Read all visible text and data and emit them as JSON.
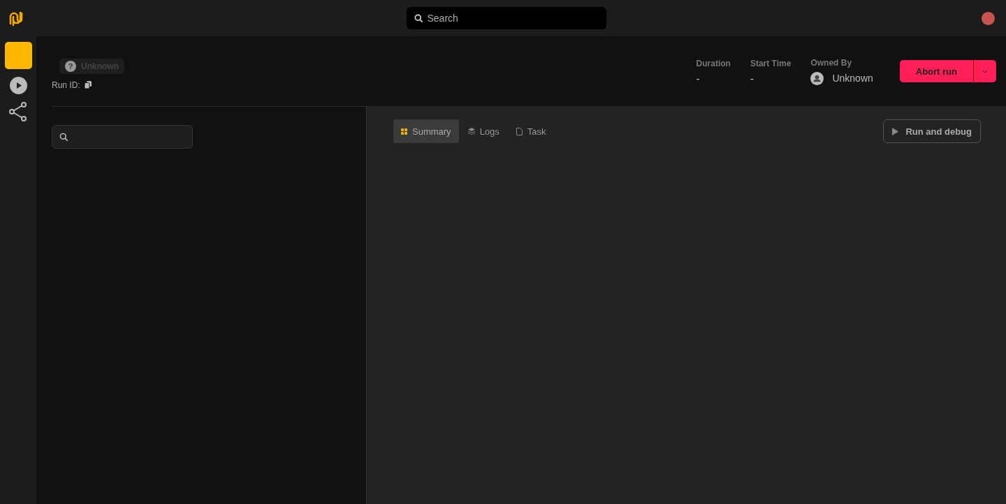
{
  "top_bar": {
    "search": {
      "placeholder": "Search"
    }
  },
  "sidebar": {
    "items": [
      {
        "kind": "square",
        "selected": true
      },
      {
        "kind": "play",
        "selected": false
      },
      {
        "kind": "share",
        "selected": false
      }
    ]
  },
  "run_header": {
    "status_icon": "?",
    "status": "Unknown",
    "run_id_label": "Run ID:",
    "stats": [
      {
        "label": "Duration",
        "value": "-"
      },
      {
        "label": "Start Time",
        "value": "-"
      }
    ],
    "owner": {
      "label": "Owned By",
      "name": "Unknown"
    },
    "abort_button": "Abort run"
  },
  "tabs": [
    {
      "label": "Summary",
      "kind": "grid",
      "selected": true
    },
    {
      "label": "Logs",
      "kind": "layers",
      "selected": false
    },
    {
      "label": "Task",
      "kind": "file",
      "selected": false
    }
  ],
  "run_debug_button": "Run and debug"
}
